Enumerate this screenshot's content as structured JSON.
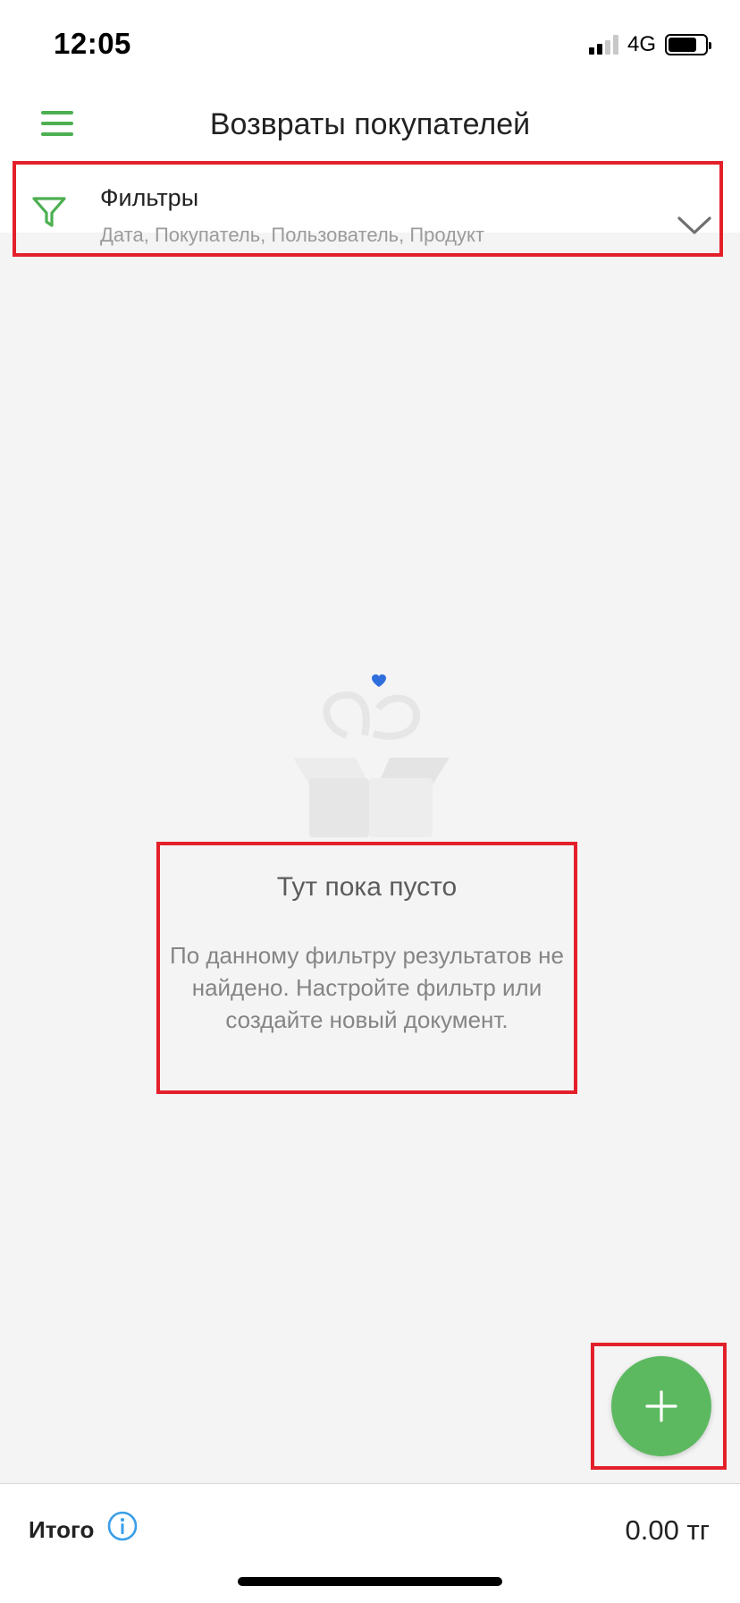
{
  "status_bar": {
    "time": "12:05",
    "network": "4G",
    "signal_bars_on": 2,
    "signal_bars_total": 4,
    "battery_level": 0.78
  },
  "header": {
    "menu_icon": "hamburger-menu-icon",
    "title": "Возвраты покупателей"
  },
  "filter": {
    "icon": "filter-funnel-icon",
    "title": "Фильтры",
    "subtitle": "Дата, Покупатель, Пользователь, Продукт",
    "expand_icon": "chevron-down-icon"
  },
  "empty_state": {
    "illustration": "open-box-icon",
    "title": "Тут пока пусто",
    "message": "По данному фильтру результатов не найдено. Настройте фильтр или создайте новый документ."
  },
  "fab": {
    "icon": "plus-icon"
  },
  "footer": {
    "total_label": "Итого",
    "info_icon": "info-icon",
    "total_value": "0.00 тг"
  },
  "colors": {
    "accent_green": "#4caf50",
    "fab_green": "#5cb960",
    "highlight_red": "#e3202a",
    "info_blue": "#3a9ee8",
    "heart_blue": "#2f6fdc"
  }
}
